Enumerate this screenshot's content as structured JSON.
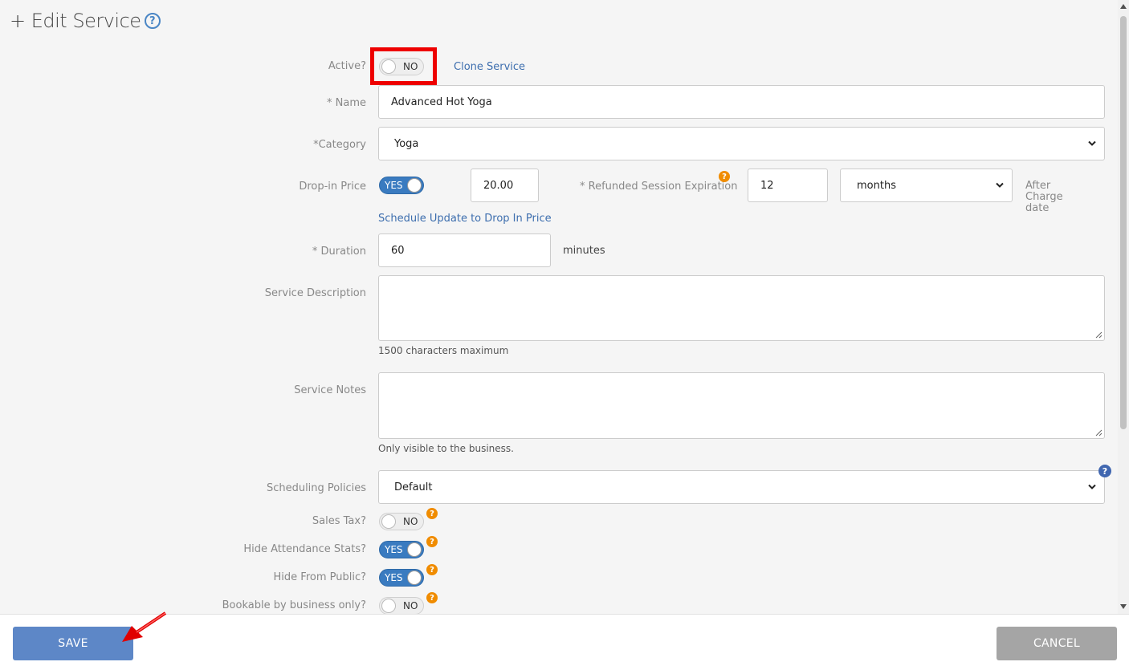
{
  "header": {
    "title": "+ Edit Service",
    "help_icon": "?"
  },
  "form": {
    "active": {
      "label": "Active?",
      "value": "NO",
      "clone_link": "Clone Service"
    },
    "name": {
      "label": "* Name",
      "value": "Advanced Hot Yoga"
    },
    "category": {
      "label": "*Category",
      "value": "Yoga"
    },
    "drop_in": {
      "label": "Drop-in Price",
      "toggle": "YES",
      "price": "20.00",
      "refund_label": "* Refunded Session Expiration",
      "refund_value": "12",
      "refund_unit": "months",
      "after_charge": "After Charge date",
      "schedule_link": "Schedule Update to Drop In Price"
    },
    "duration": {
      "label": "* Duration",
      "value": "60",
      "unit": "minutes"
    },
    "description": {
      "label": "Service Description",
      "value": "",
      "hint": "1500 characters maximum"
    },
    "notes": {
      "label": "Service Notes",
      "value": "",
      "hint": "Only visible to the business."
    },
    "scheduling": {
      "label": "Scheduling Policies",
      "value": "Default"
    },
    "sales_tax": {
      "label": "Sales Tax?",
      "value": "NO"
    },
    "hide_attendance": {
      "label": "Hide Attendance Stats?",
      "value": "YES"
    },
    "hide_public": {
      "label": "Hide From Public?",
      "value": "YES"
    },
    "bookable": {
      "label": "Bookable by business only?",
      "value": "NO"
    },
    "qmark": "?"
  },
  "footer": {
    "save": "SAVE",
    "cancel": "CANCEL"
  }
}
